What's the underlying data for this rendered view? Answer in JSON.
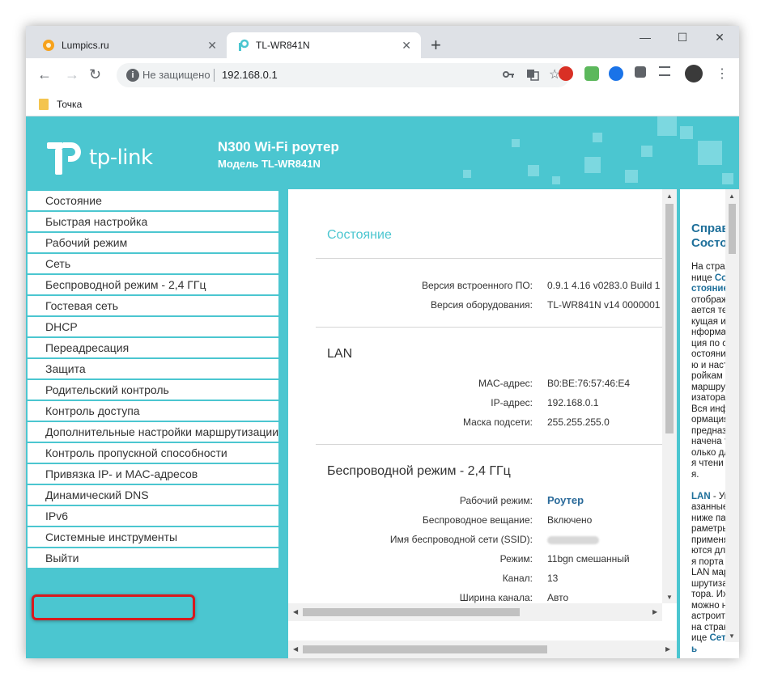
{
  "browser": {
    "tabs": [
      {
        "title": "Lumpics.ru",
        "close": "✕"
      },
      {
        "title": "TL-WR841N",
        "close": "✕"
      }
    ],
    "new_tab": "+",
    "window_controls": {
      "minimize": "—",
      "maximize": "☐",
      "close": "✕"
    },
    "nav": {
      "back": "←",
      "forward": "→",
      "reload": "↻"
    },
    "omnibox": {
      "info": "i",
      "security_label": "Не защищено",
      "url": "192.168.0.1"
    },
    "bookmarks": [
      {
        "label": "Точка"
      }
    ]
  },
  "router": {
    "logo_text": "tp-link",
    "title": "N300 Wi-Fi роутер",
    "model": "Модель TL-WR841N"
  },
  "menu": {
    "items": [
      "Состояние",
      "Быстрая настройка",
      "Рабочий режим",
      "Сеть",
      "Беспроводной режим - 2,4 ГГц",
      "Гостевая сеть",
      "DHCP",
      "Переадресация",
      "Защита",
      "Родительский контроль",
      "Контроль доступа",
      "Дополнительные настройки маршрутизации",
      "Контроль пропускной способности",
      "Привязка IP- и MAC-адресов",
      "Динамический DNS",
      "IPv6",
      "Системные инструменты",
      "Выйти"
    ],
    "highlighted_item": "Системные инструменты"
  },
  "status": {
    "header": "Состояние",
    "firmware_label": "Версия встроенного ПО:",
    "firmware_value": "0.9.1 4.16 v0283.0 Build 1",
    "hardware_label": "Версия оборудования:",
    "hardware_value": "TL-WR841N v14 0000001",
    "lan": {
      "header": "LAN",
      "mac_label": "MAC-адрес:",
      "mac_value": "B0:BE:76:57:46:E4",
      "ip_label": "IP-адрес:",
      "ip_value": "192.168.0.1",
      "mask_label": "Маска подсети:",
      "mask_value": "255.255.255.0"
    },
    "wireless": {
      "header": "Беспроводной режим - 2,4 ГГц",
      "mode_label": "Рабочий режим:",
      "mode_value": "Роутер",
      "broadcast_label": "Беспроводное вещание:",
      "broadcast_value": "Включено",
      "ssid_label": "Имя беспроводной сети (SSID):",
      "standard_label": "Режим:",
      "standard_value": "11bgn смешанный",
      "channel_label": "Канал:",
      "channel_value": "13",
      "width_label": "Ширина канала:",
      "width_value": "Авто"
    }
  },
  "help": {
    "title": "Справка Состояние",
    "text_1": "На странице ",
    "link_1": "Состояние",
    "text_2": " отображается текущая информация по состоянию и настройкам маршрутизатора. Вся информация предназначена только для чтения.",
    "link_2": "LAN",
    "text_3": " - Указанные ниже параметры применяются для порта LAN маршрутизатора. Их можно настроить на странице ",
    "link_3": "Сеть"
  },
  "colors": {
    "brand": "#4bc6d0",
    "highlight": "#d8191d",
    "link": "#1e6f9a"
  }
}
